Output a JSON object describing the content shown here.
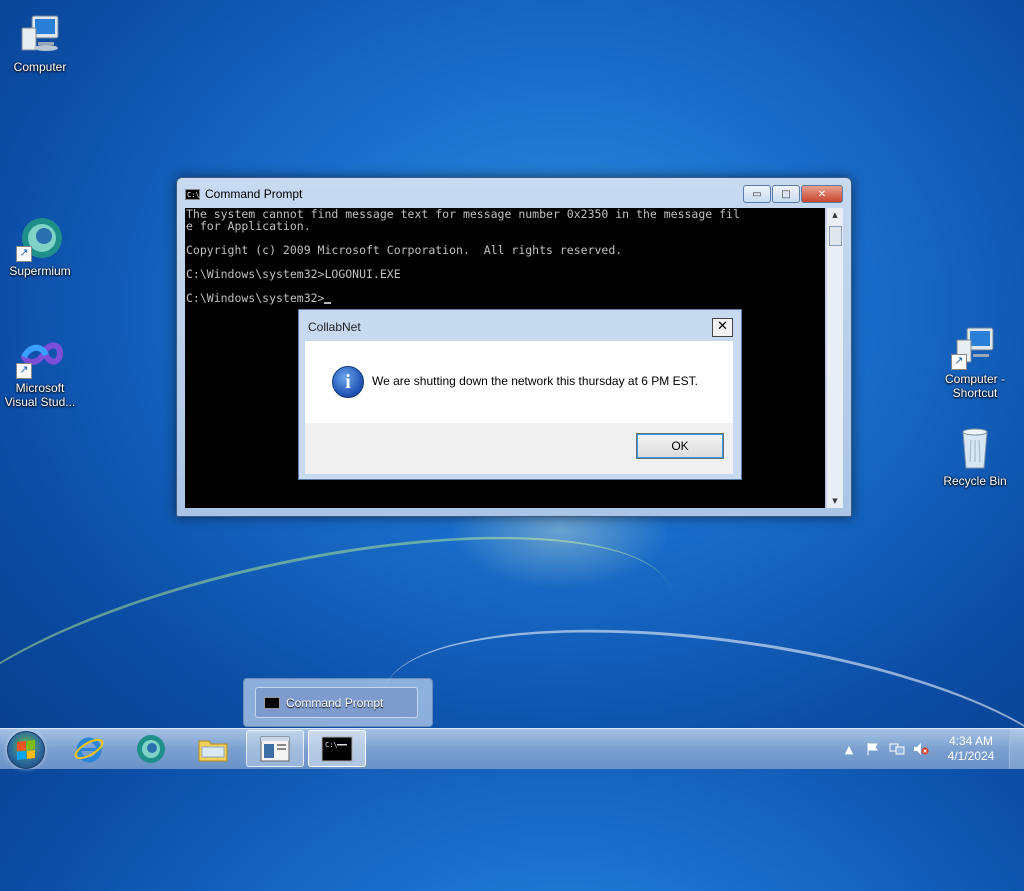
{
  "desktop": {
    "icons": [
      {
        "label": "Computer"
      },
      {
        "label": "Supermium"
      },
      {
        "label": "Microsoft Visual Stud..."
      },
      {
        "label": "Computer - Shortcut"
      },
      {
        "label": "Recycle Bin"
      }
    ]
  },
  "cmd_window": {
    "title": "Command Prompt",
    "minimize_label": "▭",
    "maximize_label": "□",
    "close_label": "✕",
    "lines": [
      "The system cannot find message text for message number 0x2350 in the message fil",
      "e for Application.",
      "",
      "Copyright (c) 2009 Microsoft Corporation.  All rights reserved.",
      "",
      "C:\\Windows\\system32>LOGONUI.EXE",
      "",
      "C:\\Windows\\system32>"
    ]
  },
  "dialog": {
    "title": "CollabNet",
    "close_label": "✕",
    "icon": "information-icon",
    "message": "We are shutting down the network this thursday at 6 PM EST.",
    "ok_label": "OK"
  },
  "taskbar_popup": {
    "item_label": "Command Prompt"
  },
  "taskbar": {
    "pinned": [
      "start-button",
      "internet-explorer",
      "supermium",
      "file-explorer",
      "app-window",
      "command-prompt"
    ],
    "clock_time": "4:34 AM",
    "clock_date": "4/1/2024"
  },
  "colors": {
    "desktop_blue": "#1a6fcc",
    "titlebar": "#c8daf0",
    "close_red": "#c8452c",
    "console_bg": "#000000",
    "console_fg": "#c0c0c0"
  }
}
